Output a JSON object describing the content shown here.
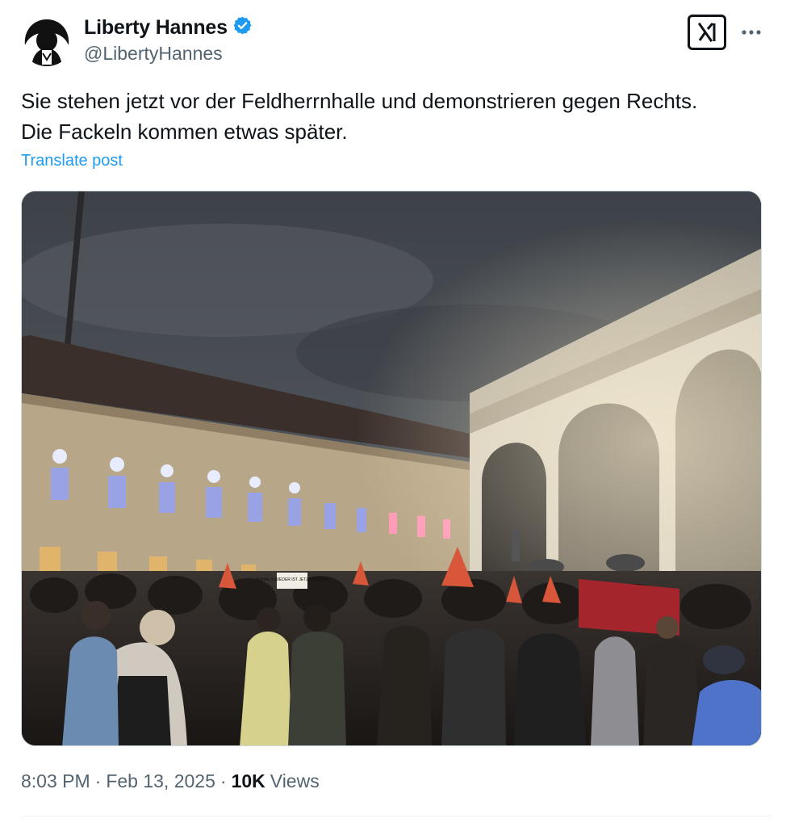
{
  "author": {
    "display_name": "Liberty Hannes",
    "handle": "@LibertyHannes",
    "verified": true,
    "verified_color": "#1d9bf0"
  },
  "header_actions": {
    "grok_icon": "grok-icon",
    "more_icon": "more-dots-icon"
  },
  "tweet": {
    "text_line1": "Sie stehen jetzt vor der Feldherrnhalle und demonstrieren gegen Rechts.",
    "text_line2": "Die Fackeln kommen etwas später.",
    "translate_label": "Translate post",
    "image_sign_text": "NIEMALS WIEDER IST JETZT EUROPA"
  },
  "meta": {
    "time": "8:03 PM",
    "separator": "·",
    "date": "Feb 13, 2025",
    "views_count": "10K",
    "views_label": "Views"
  },
  "colors": {
    "link": "#1d9bf0",
    "secondary_text": "#536471",
    "primary_text": "#0f1419"
  }
}
